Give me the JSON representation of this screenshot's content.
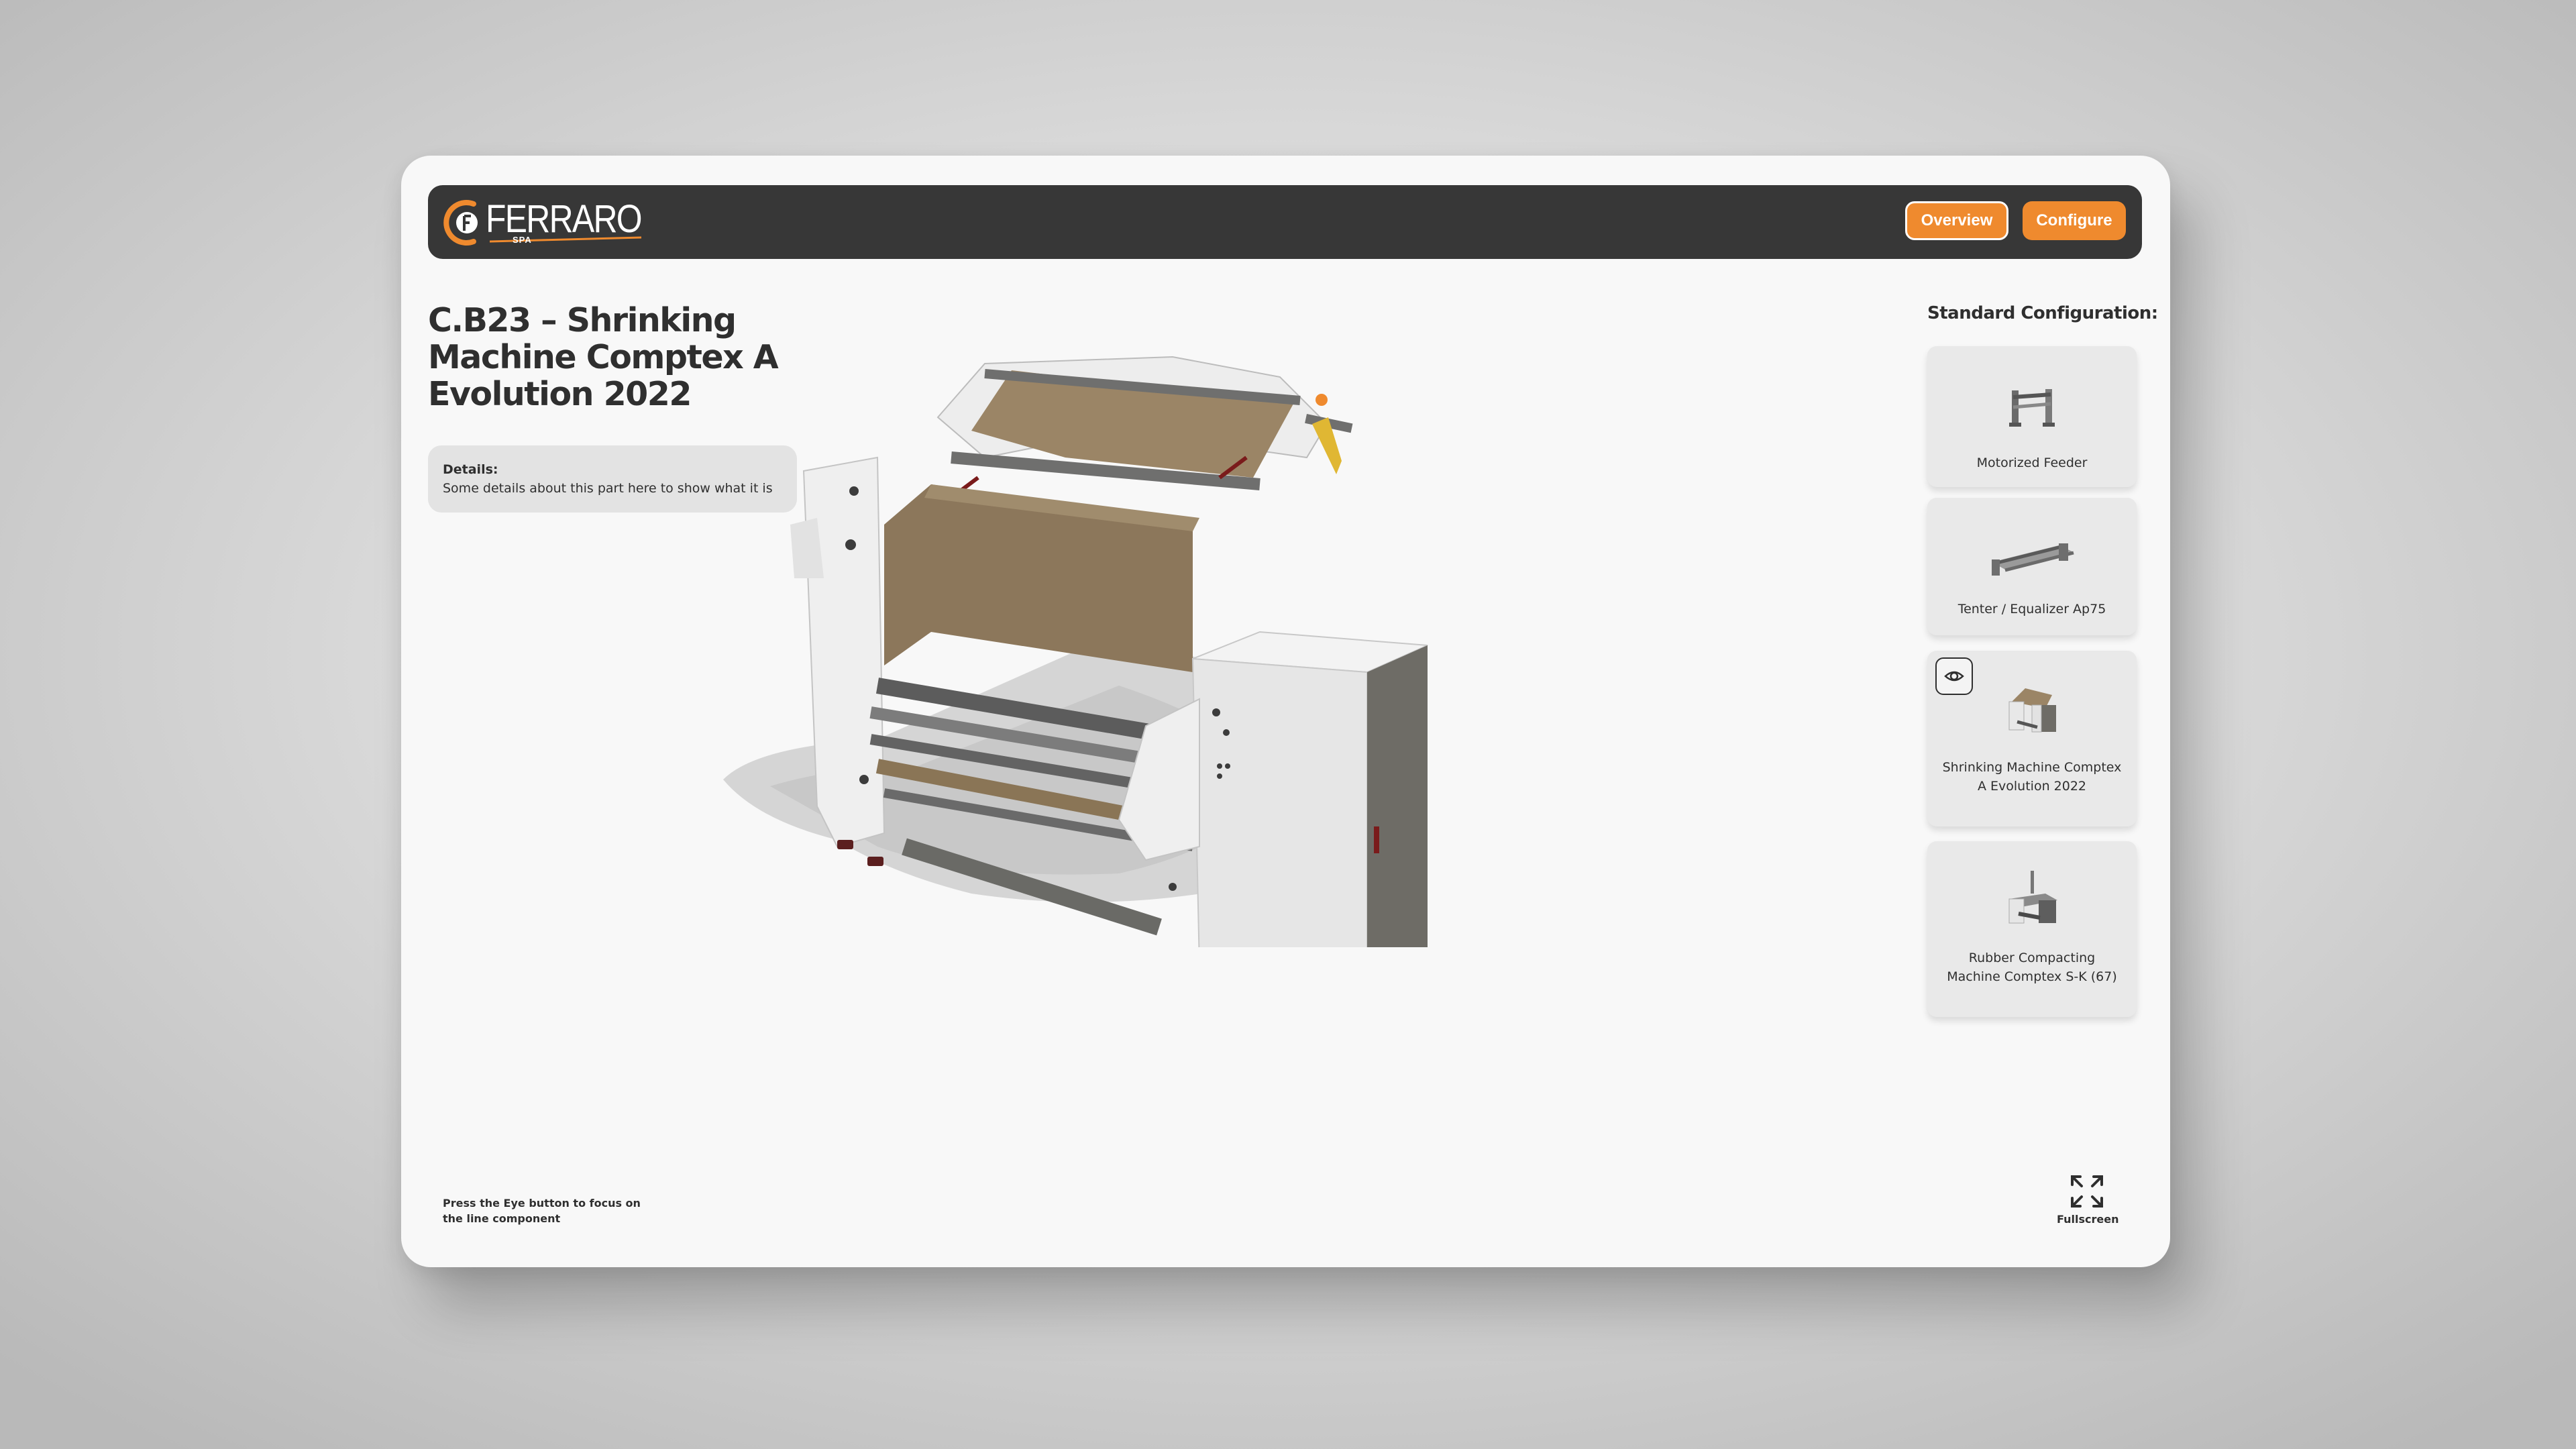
{
  "brand": {
    "logo_text": "FERRARO",
    "logo_sub": "SPA",
    "accent_color": "#ef8a2e",
    "navbar_color": "#373737"
  },
  "nav": {
    "overview_label": "Overview",
    "configure_label": "Configure"
  },
  "product": {
    "title": "C.B23 – Shrinking Machine Comptex A Evolution 2022",
    "details_label": "Details:",
    "details_text": "Some details about this part here to show what it is"
  },
  "config": {
    "heading": "Standard Configuration:",
    "items": [
      {
        "label": "Motorized Feeder",
        "icon": "feeder-thumbnail"
      },
      {
        "label": "Tenter / Equalizer Ap75",
        "icon": "tenter-thumbnail"
      },
      {
        "label": "Shrinking Machine Comptex A Evolution 2022",
        "icon": "shrinking-machine-thumbnail",
        "focused": true
      },
      {
        "label": "Rubber Compacting Machine Comptex S-K (67)",
        "icon": "compacting-machine-thumbnail"
      }
    ]
  },
  "footer": {
    "hint": "Press the Eye button to focus on the line component",
    "fullscreen_label": "Fullscreen"
  }
}
